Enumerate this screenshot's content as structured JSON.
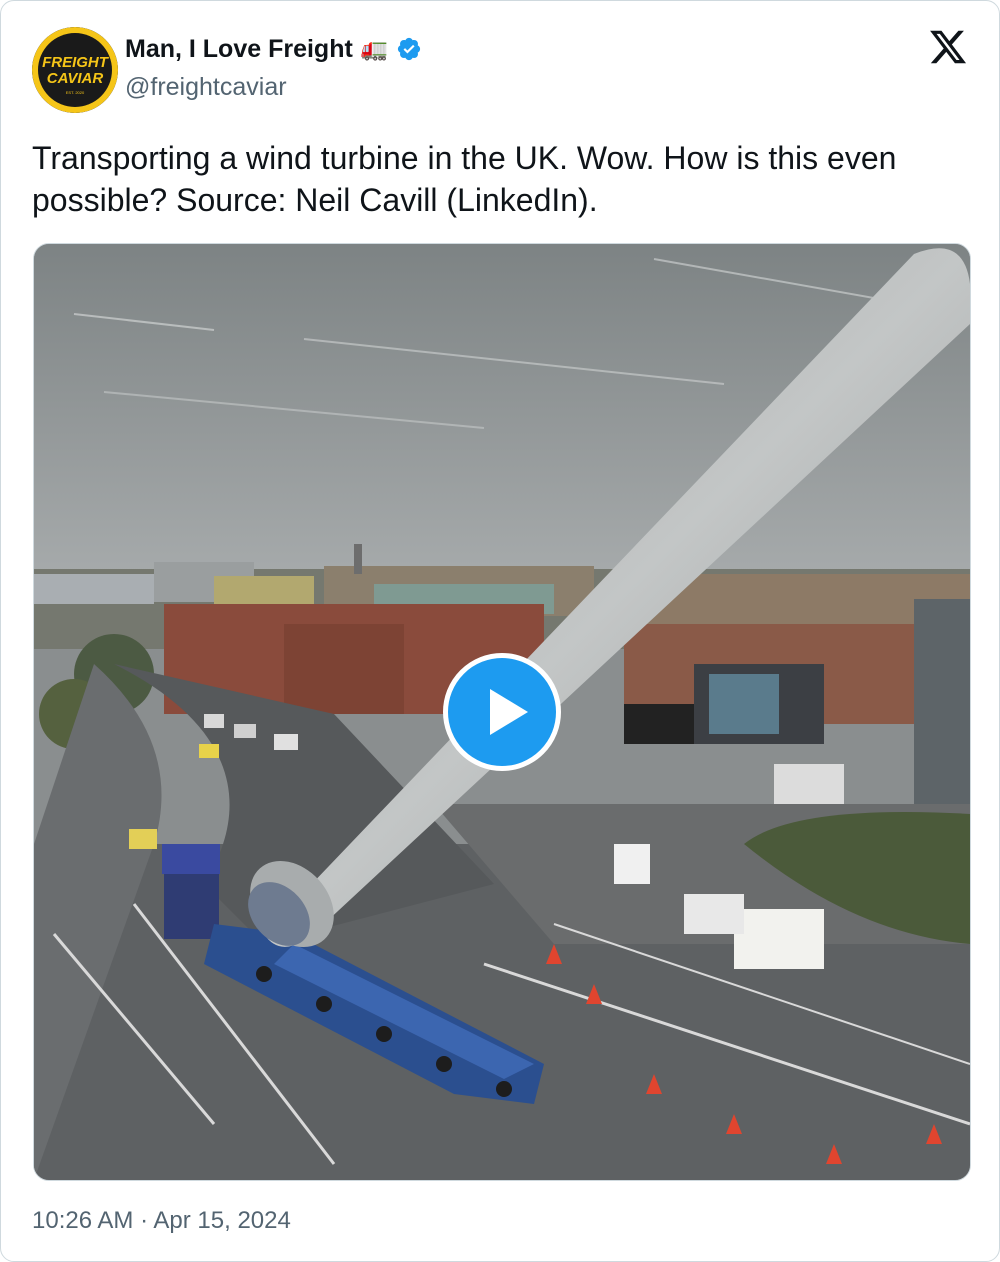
{
  "author": {
    "display_name": "Man, I Love Freight",
    "emoji": "🚛",
    "handle": "@freightcaviar",
    "verified": true,
    "avatar": {
      "line1": "FREIGHT",
      "line2": "CAVIAR",
      "est": "EST. 2020"
    }
  },
  "platform_icon": "x-logo",
  "tweet": {
    "text": "Transporting a wind turbine in the UK. Wow. How is this even possible? Source: Neil Cavill (LinkedIn)."
  },
  "media": {
    "type": "video",
    "play_icon": "play-icon",
    "description_icon": "video-thumbnail"
  },
  "timestamp": "10:26 AM · Apr 15, 2024",
  "colors": {
    "accent": "#1d9bf0",
    "text_primary": "#0f1419",
    "text_secondary": "#536471",
    "avatar_yellow": "#f5c518"
  }
}
